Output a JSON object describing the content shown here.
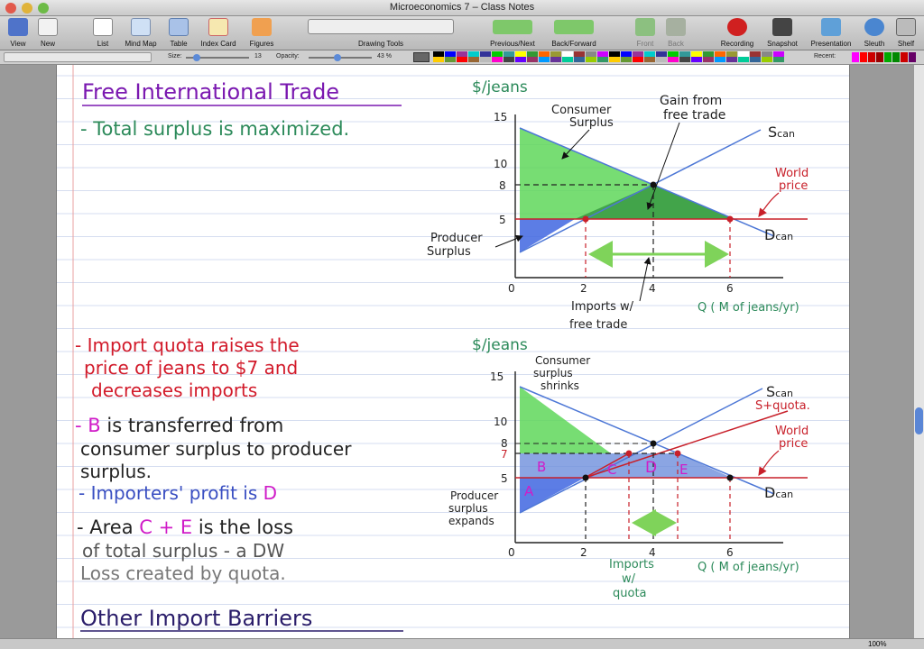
{
  "window": {
    "title": "Microeconomics 7 – Class Notes"
  },
  "toolbar": {
    "items": [
      {
        "label": "View"
      },
      {
        "label": "New"
      },
      {
        "label": "List"
      },
      {
        "label": "Mind Map"
      },
      {
        "label": "Table"
      },
      {
        "label": "Index Card"
      },
      {
        "label": "Figures"
      },
      {
        "label": "Drawing Tools"
      },
      {
        "label": "Previous/Next"
      },
      {
        "label": "Back/Forward"
      },
      {
        "label": "Front"
      },
      {
        "label": "Back"
      },
      {
        "label": "Recording"
      },
      {
        "label": "Snapshot"
      },
      {
        "label": "Presentation"
      },
      {
        "label": "Sleuth"
      },
      {
        "label": "Shelf"
      }
    ]
  },
  "format_bar": {
    "size_label": "Size:",
    "size_value": "13",
    "opacity_label": "Opacity:",
    "opacity_value": "43 %",
    "recent_label": "Recent:"
  },
  "status": {
    "zoom": "100%"
  },
  "notes": {
    "heading1": "Free International Trade",
    "line1": "- Total surplus is maximized.",
    "quota1": "- Import quota raises the",
    "quota2": "price of jeans to $7 and",
    "quota3": "decreases imports",
    "b_dash": "- ",
    "b_letter": "B",
    "b_rest": " is transferred from",
    "b2": "consumer surplus to producer",
    "b3": "surplus.",
    "imp_text": "- Importers' profit is ",
    "imp_letter": "D",
    "area_a": "- Area ",
    "area_c": "C",
    "area_plus": " + ",
    "area_e": "E",
    "area_b": " is the loss",
    "area2": "of total surplus - a DW",
    "area3": "Loss created by quota.",
    "heading2": "Other Import Barriers"
  },
  "graph1": {
    "ylabel": "$/jeans",
    "xlabel": "Q ( M of jeans/yr)",
    "yticks": [
      "15",
      "10",
      "8",
      "5",
      "0"
    ],
    "xticks": [
      "2",
      "4",
      "6"
    ],
    "cs_label1": "Consumer",
    "cs_label2": "Surplus",
    "gain1": "Gain from",
    "gain2": "free trade",
    "supply1": "S",
    "supply2": "can",
    "world1": "World",
    "world2": "price",
    "ps1": "Producer",
    "ps2": "Surplus",
    "demand1": "D",
    "demand2": "can",
    "imports1": "Imports  w/",
    "imports2": "free trade"
  },
  "graph2": {
    "ylabel": "$/jeans",
    "xlabel": "Q ( M of jeans/yr)",
    "yticks": [
      "15",
      "10",
      "8",
      "7",
      "5",
      "0"
    ],
    "xticks": [
      "2",
      "4",
      "6"
    ],
    "cs1": "Consumer",
    "cs2": "surplus",
    "cs3": "shrinks",
    "supply1": "S",
    "supply2": "can",
    "squota": "S+quota.",
    "world1": "World",
    "world2": "price",
    "ps1": "Producer",
    "ps2": "surplus",
    "ps3": "expands",
    "demand1": "D",
    "demand2": "can",
    "area_a": "A",
    "area_b": "B",
    "area_c": "C",
    "area_d": "D",
    "area_e": "E",
    "imports1": "Imports",
    "imports2": "w/",
    "imports3": "quota"
  },
  "colors": {
    "purple": "#7a18b0",
    "green": "#2c8a5a",
    "red": "#d21a2a",
    "magenta": "#d01cc8",
    "blue_ink": "#3a4fc2",
    "gray_ink": "#777777",
    "supply_line": "#4d77d6",
    "price_line": "#c8202a",
    "green_fill": "#5fd75a",
    "blue_fill": "#3f66e0",
    "rule": "#b9c6e8",
    "margin": "#e8a0a0"
  }
}
